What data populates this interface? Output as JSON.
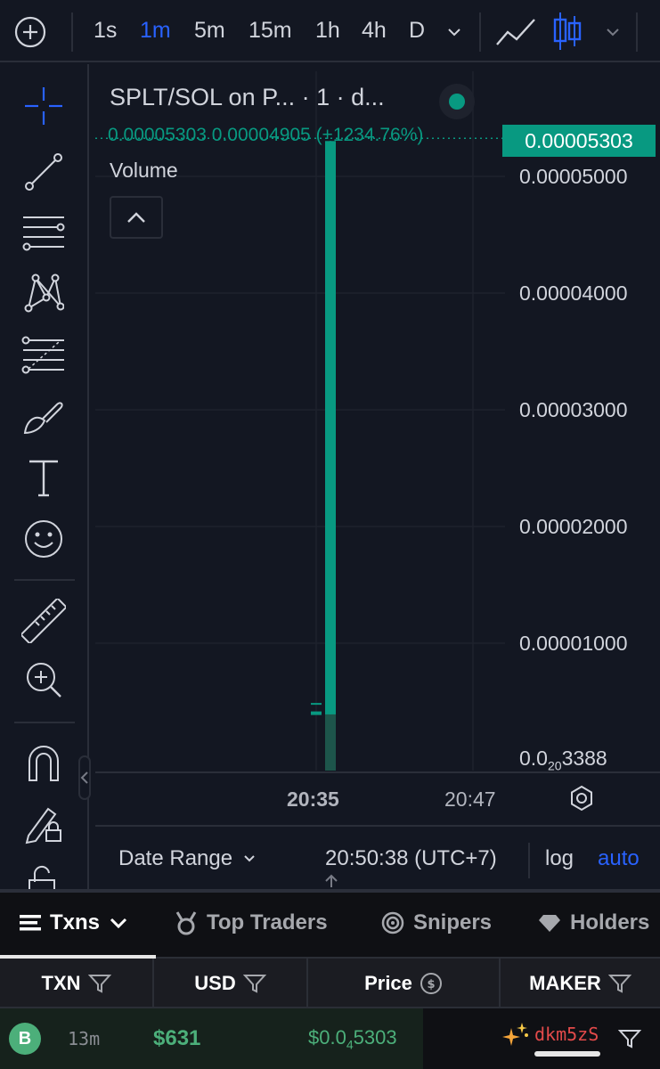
{
  "toolbar": {
    "timeframes": [
      {
        "label": "1s",
        "active": false
      },
      {
        "label": "1m",
        "active": true
      },
      {
        "label": "5m",
        "active": false
      },
      {
        "label": "15m",
        "active": false
      },
      {
        "label": "1h",
        "active": false
      },
      {
        "label": "4h",
        "active": false
      },
      {
        "label": "D",
        "active": false
      }
    ],
    "icons": [
      "add-indicator-icon",
      "chevron-down-icon",
      "line-chart-icon",
      "candlestick-icon",
      "chevron-down-icon"
    ]
  },
  "left_tools": [
    "crosshair-icon",
    "trend-line-icon",
    "horizontal-lines-icon",
    "pattern-icon",
    "fib-retracement-icon",
    "brush-icon",
    "text-icon",
    "emoji-icon",
    "ruler-icon",
    "zoom-in-icon",
    "magnet-icon",
    "lock-drawing-icon",
    "unlock-icon"
  ],
  "legend": {
    "title": "SPLT/SOL on P...  · 1 · d...",
    "values": "0.00005303  0.00004905 (+1234.76%)",
    "volume_label": "Volume"
  },
  "price_axis": {
    "current_price": "0.00005303",
    "labels": [
      "0.00005000",
      "0.00004000",
      "0.00003000",
      "0.00002000",
      "0.00001000"
    ],
    "bottom_label_main": "0.0",
    "bottom_label_sub": "20",
    "bottom_label_tail": "3388"
  },
  "chart_data": {
    "type": "candlestick",
    "y_scale": "linear",
    "ylim": [
      0.0,
      5.25e-05
    ],
    "candles": [
      {
        "time": "20:34",
        "open": 4e-06,
        "close": 4e-06,
        "high": 4.8e-06,
        "low": 4e-06,
        "color": "#089981"
      },
      {
        "time": "20:35",
        "open": 3.9e-06,
        "close": 5.303e-05,
        "high": 5.303e-05,
        "low": 3.9e-06,
        "color": "#089981"
      }
    ],
    "volume": [
      {
        "time": "20:35",
        "value": 0.12
      }
    ],
    "x_ticks": [
      "20:35",
      "20:47"
    ],
    "grid": true
  },
  "time_axis": {
    "label_bold": "20:35",
    "label_normal": "20:47"
  },
  "bottom_bar": {
    "date_range": "Date Range",
    "clock": "20:50:38 (UTC+7)",
    "log": "log",
    "auto": "auto"
  },
  "tabs": [
    {
      "label": "Txns",
      "active": true
    },
    {
      "label": "Top Traders",
      "active": false
    },
    {
      "label": "Snipers",
      "active": false
    },
    {
      "label": "Holders",
      "active": false
    }
  ],
  "table": {
    "columns": [
      "TXN",
      "USD",
      "Price",
      "MAKER"
    ],
    "rows": [
      {
        "type": "B",
        "age": "13m",
        "usd": "$631",
        "price_main": "$0.0",
        "price_sub": "4",
        "price_tail": "5303",
        "maker": "dkm5zS",
        "maker_icon": "sparkles-icon"
      }
    ]
  },
  "colors": {
    "up": "#089981",
    "accent": "#2962ff",
    "buy": "#4caf7a",
    "maker_red": "#e34a4a"
  }
}
